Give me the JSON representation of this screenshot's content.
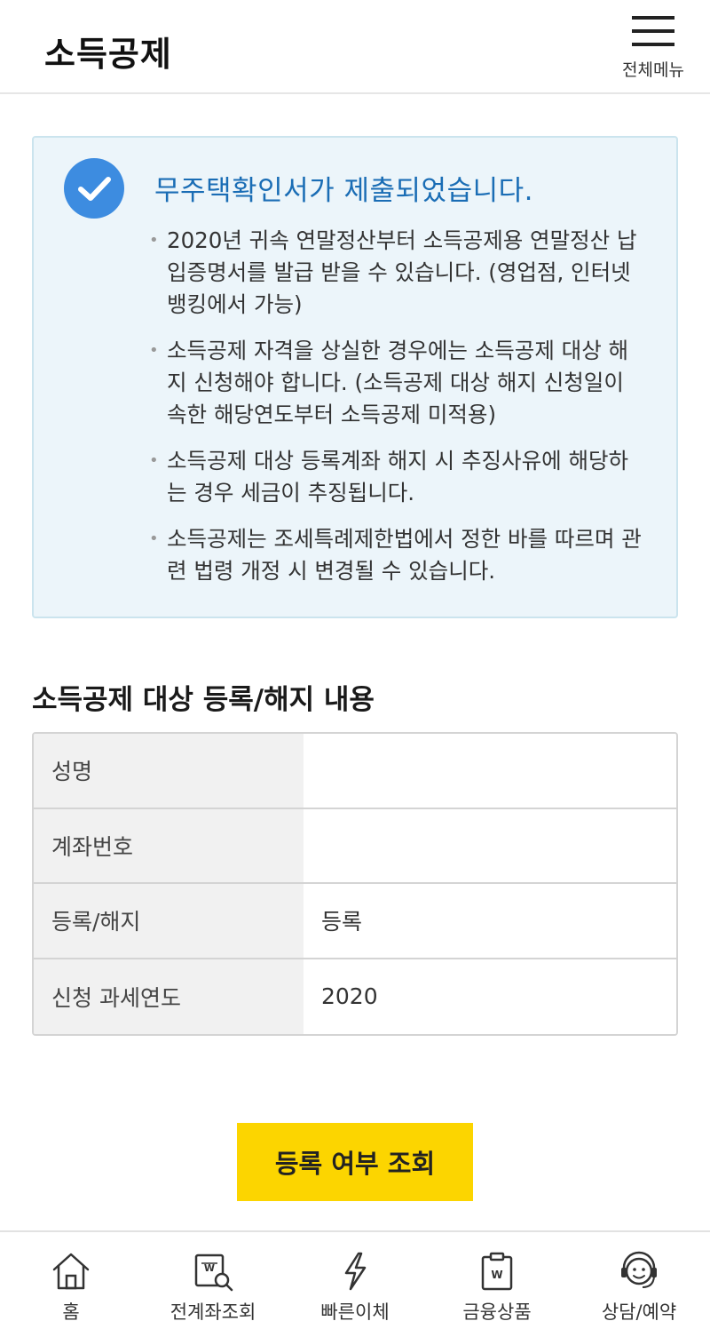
{
  "header": {
    "title": "소득공제",
    "menu_icon": "hamburger-icon",
    "menu_label": "전체메뉴"
  },
  "notice": {
    "icon": "check-circle-icon",
    "title": "무주택확인서가 제출되었습니다.",
    "items": [
      "2020년 귀속 연말정산부터 소득공제용 연말정산 납입증명서를 발급 받을 수 있습니다. (영업점, 인터넷뱅킹에서 가능)",
      "소득공제 자격을 상실한 경우에는 소득공제 대상 해지 신청해야 합니다. (소득공제 대상 해지 신청일이 속한 해당연도부터 소득공제 미적용)",
      "소득공제 대상 등록계좌 해지 시 추징사유에 해당하는 경우 세금이 추징됩니다.",
      "소득공제는 조세특례제한법에서 정한 바를 따르며 관련 법령 개정 시 변경될 수 있습니다."
    ]
  },
  "section": {
    "title": "소득공제 대상 등록/해지 내용"
  },
  "table": {
    "rows": [
      {
        "label": "성명",
        "value": ""
      },
      {
        "label": "계좌번호",
        "value": ""
      },
      {
        "label": "등록/해지",
        "value": "등록"
      },
      {
        "label": "신청 과세연도",
        "value": "2020"
      }
    ]
  },
  "action": {
    "label": "등록 여부 조회"
  },
  "bottom_nav": {
    "items": [
      {
        "label": "홈",
        "icon": "home-icon"
      },
      {
        "label": "전계좌조회",
        "icon": "account-search-icon"
      },
      {
        "label": "빠른이체",
        "icon": "lightning-icon"
      },
      {
        "label": "금융상품",
        "icon": "product-clipboard-icon"
      },
      {
        "label": "상담/예약",
        "icon": "headset-icon"
      }
    ]
  },
  "colors": {
    "accent_yellow": "#fcd500",
    "notice_blue": "#1a6db5",
    "check_circle": "#3d8ce0",
    "notice_bg": "#ecf5fa"
  }
}
